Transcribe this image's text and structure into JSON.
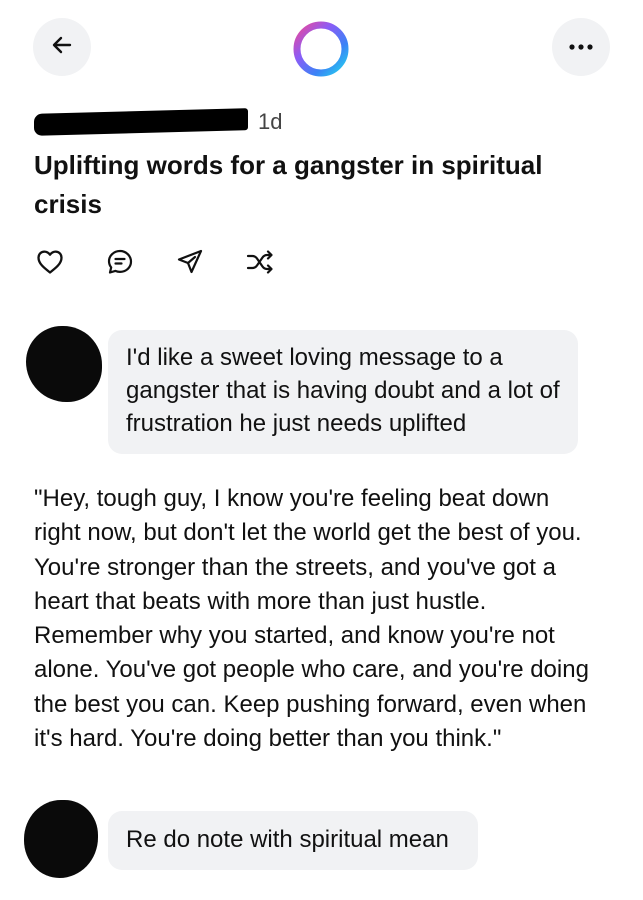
{
  "header": {
    "back_icon": "arrow-left-icon",
    "logo_icon": "ring-logo-icon",
    "more_icon": "ellipsis-icon",
    "logo_colors": [
      "#3b82f6",
      "#8b5cf6",
      "#ec4899",
      "#22d3ee"
    ]
  },
  "post": {
    "time_ago": "1d",
    "title": "Uplifting words for a gangster in spiritual crisis",
    "actions": [
      {
        "icon": "heart-icon"
      },
      {
        "icon": "comment-icon"
      },
      {
        "icon": "send-icon"
      },
      {
        "icon": "shuffle-icon"
      }
    ]
  },
  "conversation": {
    "prompt_1": "I'd like a sweet loving message to a gangster that is having doubt and a lot of frustration he just needs uplifted",
    "response_1": "\"Hey, tough guy, I know you're feeling beat down right now, but don't let the world get the best of you. You're stronger than the streets, and you've got a heart that beats with more than just hustle. Remember why you started, and know you're not alone. You've got people who care, and you're doing the best you can. Keep pushing forward, even when it's hard. You're doing better than you think.\"",
    "prompt_2": "Re do note with spiritual mean"
  }
}
